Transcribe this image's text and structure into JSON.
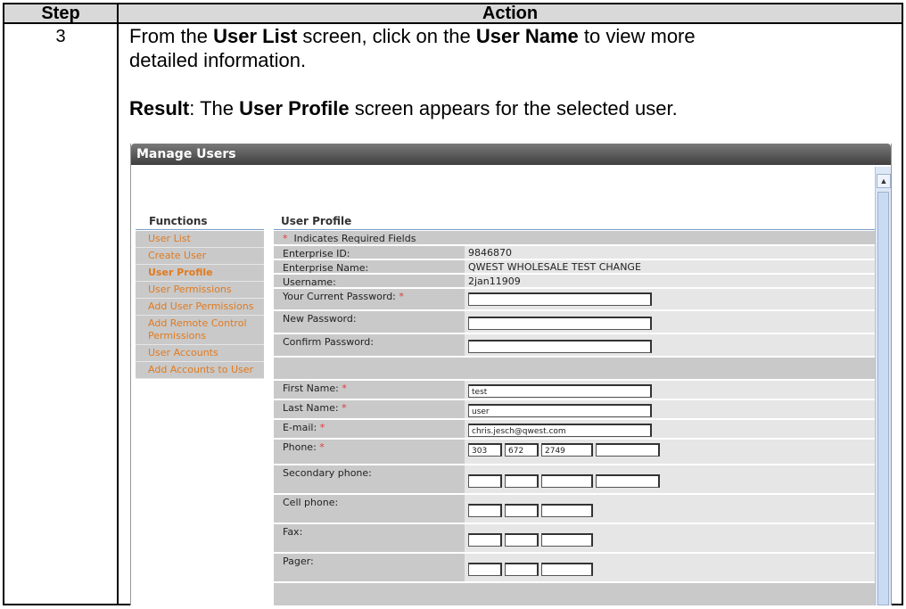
{
  "doc": {
    "header_step": "Step",
    "header_action": "Action",
    "step_number": "3",
    "line1_pre": "From the ",
    "line1_b1": "User List",
    "line1_mid": " screen, click on the ",
    "line1_b2": "User Name",
    "line1_post": " to view more",
    "line2": "detailed information.",
    "result_label": "Result",
    "result_pre": ":  The ",
    "result_b": "User Profile",
    "result_post": " screen appears for the selected user."
  },
  "window": {
    "title": "Manage Users"
  },
  "functions": {
    "heading": "Functions",
    "items": [
      {
        "label": "User List"
      },
      {
        "label": "Create User"
      },
      {
        "label": "User Profile"
      },
      {
        "label": "User Permissions"
      },
      {
        "label": "Add User Permissions"
      },
      {
        "label": "Add Remote Control Permissions"
      },
      {
        "label": "User Accounts"
      },
      {
        "label": "Add Accounts to User"
      }
    ]
  },
  "profile": {
    "heading": "User Profile",
    "req_marker": "*",
    "req_note": "Indicates Required Fields",
    "enterprise_id_label": "Enterprise ID:",
    "enterprise_id": "9846870",
    "enterprise_name_label": "Enterprise Name:",
    "enterprise_name": "QWEST WHOLESALE TEST CHANGE",
    "username_label": "Username:",
    "username": "2jan11909",
    "current_password_label": "Your Current Password:",
    "new_password_label": "New Password:",
    "confirm_password_label": "Confirm Password:",
    "first_name_label": "First Name:",
    "first_name": "test",
    "last_name_label": "Last Name:",
    "last_name": "user",
    "email_label": "E-mail:",
    "email": "chris.jesch@qwest.com",
    "phone_label": "Phone:",
    "phone_area": "303",
    "phone_prefix": "672",
    "phone_line": "2749",
    "secondary_phone_label": "Secondary phone:",
    "cell_phone_label": "Cell phone:",
    "fax_label": "Fax:",
    "pager_label": "Pager:"
  }
}
